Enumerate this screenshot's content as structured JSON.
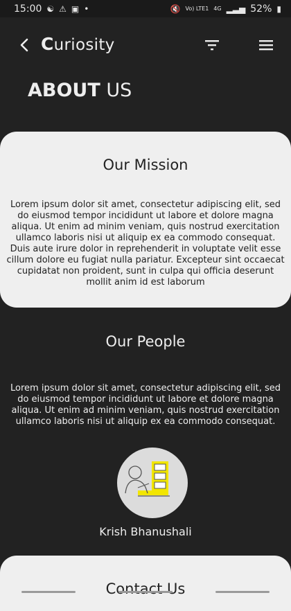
{
  "status_bar": {
    "time": "15:00",
    "network": "Vo) LTE1",
    "signal_type": "4G",
    "battery": "52%"
  },
  "app_bar": {
    "title_first": "C",
    "title_rest": "uriosity",
    "icons": [
      "chevron-left-icon",
      "filter-icon",
      "hamburger-menu-icon"
    ]
  },
  "page": {
    "heading_bold": "ABOUT",
    "heading_rest": " US"
  },
  "mission": {
    "title": "Our Mission",
    "body": "Lorem ipsum dolor sit amet, consectetur adipiscing elit, sed do eiusmod tempor incididunt ut labore et dolore magna aliqua. Ut enim ad minim veniam, quis nostrud exercitation ullamco laboris nisi ut aliquip ex ea commodo consequat. Duis aute irure dolor in reprehenderit in voluptate velit esse cillum dolore eu fugiat nulla pariatur. Excepteur sint occaecat cupidatat non proident, sunt in culpa qui officia deserunt mollit anim id est laborum"
  },
  "people": {
    "title": "Our People",
    "body": "Lorem ipsum dolor sit amet, consectetur adipiscing elit, sed do eiusmod tempor incididunt ut labore et dolore magna aliqua. Ut enim ad minim veniam, quis nostrud exercitation ullamco laboris nisi ut aliquip ex ea commodo consequat.",
    "members": [
      {
        "name": "Krish Bhanushali"
      }
    ]
  },
  "contact": {
    "title": "Contact Us"
  },
  "colors": {
    "background": "#222222",
    "card": "#efefef",
    "accent": "#f2e600"
  }
}
